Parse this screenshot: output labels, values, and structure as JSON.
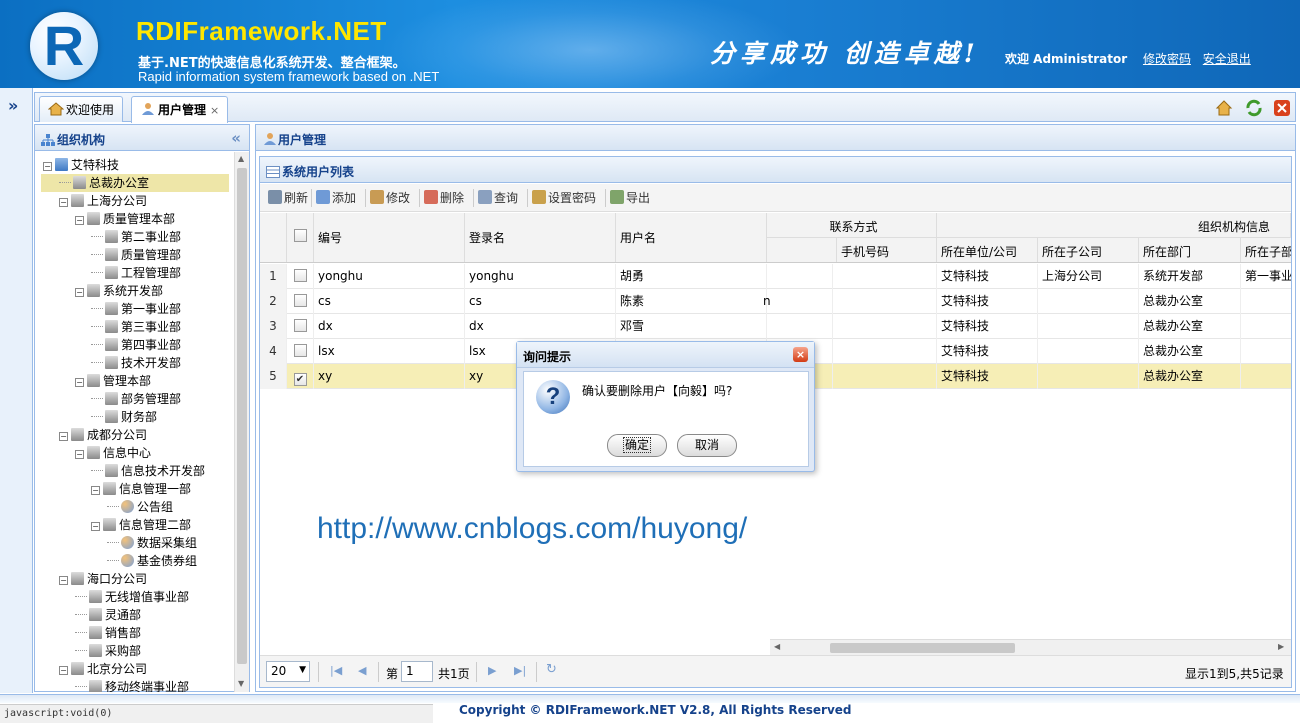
{
  "header": {
    "logo_letter": "R",
    "title": "RDIFramework.NET",
    "subtitle_cn": "基于.NET的快速信息化系统开发、整合框架。",
    "subtitle_en": "Rapid information system framework based on .NET",
    "slogan": "分享成功  创造卓越!",
    "welcome": "欢迎 Administrator",
    "change_password": "修改密码",
    "logout": "安全退出"
  },
  "tabs": [
    {
      "label": "欢迎使用",
      "icon": "home-icon",
      "active": false
    },
    {
      "label": "用户管理",
      "icon": "user-icon",
      "active": true,
      "close": "×"
    }
  ],
  "tree_panel": {
    "title": "组织机构",
    "nodes": [
      {
        "label": "艾特科技",
        "level": 0,
        "toggle": "−",
        "icon": "org"
      },
      {
        "label": "总裁办公室",
        "level": 1,
        "icon": "bld",
        "selected": true
      },
      {
        "label": "上海分公司",
        "level": 1,
        "toggle": "−",
        "icon": "bld"
      },
      {
        "label": "质量管理本部",
        "level": 2,
        "toggle": "−",
        "icon": "bld"
      },
      {
        "label": "第二事业部",
        "level": 3,
        "icon": "bld"
      },
      {
        "label": "质量管理部",
        "level": 3,
        "icon": "bld"
      },
      {
        "label": "工程管理部",
        "level": 3,
        "icon": "bld"
      },
      {
        "label": "系统开发部",
        "level": 2,
        "toggle": "−",
        "icon": "bld"
      },
      {
        "label": "第一事业部",
        "level": 3,
        "icon": "bld"
      },
      {
        "label": "第三事业部",
        "level": 3,
        "icon": "bld"
      },
      {
        "label": "第四事业部",
        "level": 3,
        "icon": "bld"
      },
      {
        "label": "技术开发部",
        "level": 3,
        "icon": "bld"
      },
      {
        "label": "管理本部",
        "level": 2,
        "toggle": "−",
        "icon": "bld"
      },
      {
        "label": "部务管理部",
        "level": 3,
        "icon": "bld"
      },
      {
        "label": "财务部",
        "level": 3,
        "icon": "bld"
      },
      {
        "label": "成都分公司",
        "level": 1,
        "toggle": "−",
        "icon": "bld"
      },
      {
        "label": "信息中心",
        "level": 2,
        "toggle": "−",
        "icon": "bld"
      },
      {
        "label": "信息技术开发部",
        "level": 3,
        "icon": "bld"
      },
      {
        "label": "信息管理一部",
        "level": 3,
        "toggle": "−",
        "icon": "bld"
      },
      {
        "label": "公告组",
        "level": 4,
        "icon": "grp"
      },
      {
        "label": "信息管理二部",
        "level": 3,
        "toggle": "−",
        "icon": "bld"
      },
      {
        "label": "数据采集组",
        "level": 4,
        "icon": "grp"
      },
      {
        "label": "基金债券组",
        "level": 4,
        "icon": "grp"
      },
      {
        "label": "海口分公司",
        "level": 1,
        "toggle": "−",
        "icon": "bld"
      },
      {
        "label": "无线增值事业部",
        "level": 2,
        "icon": "bld"
      },
      {
        "label": "灵通部",
        "level": 2,
        "icon": "bld"
      },
      {
        "label": "销售部",
        "level": 2,
        "icon": "bld"
      },
      {
        "label": "采购部",
        "level": 2,
        "icon": "bld"
      },
      {
        "label": "北京分公司",
        "level": 1,
        "toggle": "−",
        "icon": "bld"
      },
      {
        "label": "移动终端事业部",
        "level": 2,
        "icon": "bld"
      }
    ]
  },
  "main_panel": {
    "title": "用户管理",
    "grid_title": "系统用户列表",
    "toolbar": [
      {
        "label": "刷新",
        "icon": "refresh-icon",
        "color": "#7a8fa8"
      },
      {
        "label": "添加",
        "icon": "add-user-icon",
        "color": "#6f9ad6"
      },
      {
        "label": "修改",
        "icon": "edit-icon",
        "color": "#c89b54"
      },
      {
        "label": "删除",
        "icon": "delete-icon",
        "color": "#d66b5a"
      },
      {
        "label": "查询",
        "icon": "search-icon",
        "color": "#8aa0bf"
      },
      {
        "label": "设置密码",
        "icon": "key-icon",
        "color": "#c9a14c"
      },
      {
        "label": "导出",
        "icon": "export-icon",
        "color": "#7fa46a"
      }
    ],
    "group_headers": {
      "contact": "联系方式",
      "org": "组织机构信息"
    },
    "columns": [
      "编号",
      "登录名",
      "用户名",
      "",
      "手机号码",
      "所在单位/公司",
      "所在子公司",
      "所在部门",
      "所在子部"
    ],
    "rows": [
      {
        "n": "1",
        "checked": false,
        "cells": [
          "yonghu",
          "yonghu",
          "胡勇",
          "",
          "",
          "艾特科技",
          "上海分公司",
          "系统开发部",
          "第一事业"
        ]
      },
      {
        "n": "2",
        "checked": false,
        "cells": [
          "cs",
          "cs",
          "陈素",
          "n",
          "",
          "艾特科技",
          "",
          "总裁办公室",
          ""
        ]
      },
      {
        "n": "3",
        "checked": false,
        "cells": [
          "dx",
          "dx",
          "邓雪",
          "",
          "",
          "艾特科技",
          "",
          "总裁办公室",
          ""
        ]
      },
      {
        "n": "4",
        "checked": false,
        "cells": [
          "lsx",
          "lsx",
          "",
          "",
          "",
          "艾特科技",
          "",
          "总裁办公室",
          ""
        ]
      },
      {
        "n": "5",
        "checked": true,
        "cells": [
          "xy",
          "xy",
          "",
          "",
          "",
          "艾特科技",
          "",
          "总裁办公室",
          ""
        ]
      }
    ],
    "pager": {
      "page_size": "20",
      "page_prefix": "第",
      "page_number": "1",
      "page_total": "共1页",
      "summary": "显示1到5,共5记录"
    }
  },
  "dialog": {
    "title": "询问提示",
    "message": "确认要删除用户【向毅】吗?",
    "ok": "确定",
    "cancel": "取消"
  },
  "watermark": "http://www.cnblogs.com/huyong/",
  "statusbar": "javascript:void(0)",
  "copyright": "Copyright © RDIFramework.NET V2.8, All Rights Reserved"
}
